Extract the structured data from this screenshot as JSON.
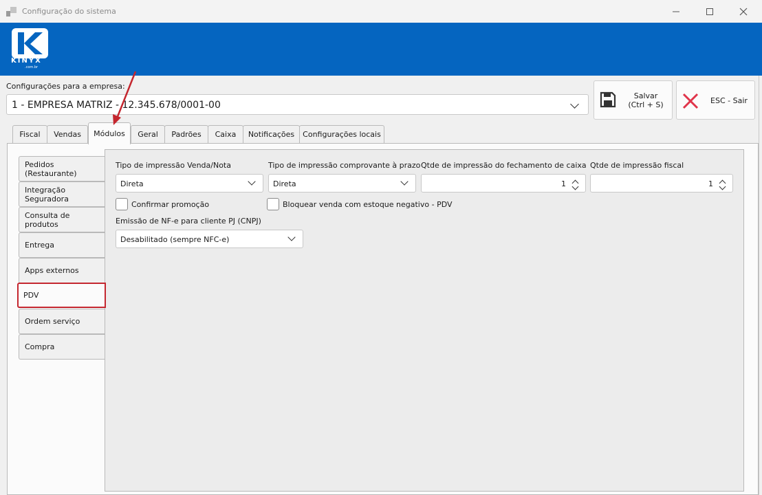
{
  "window": {
    "title": "Configuração do sistema"
  },
  "banner": {
    "logo_text": "KINYX",
    "logo_sub": ".com.br"
  },
  "company": {
    "label": "Configurações para a empresa:",
    "value": "1 - EMPRESA MATRIZ - 12.345.678/0001-00"
  },
  "toolbar": {
    "save_label_line1": "Salvar",
    "save_label_line2": "(Ctrl + S)",
    "exit_label": "ESC - Sair"
  },
  "tabs": [
    {
      "label": "Fiscal"
    },
    {
      "label": "Vendas"
    },
    {
      "label": "Módulos"
    },
    {
      "label": "Geral"
    },
    {
      "label": "Padrões"
    },
    {
      "label": "Caixa"
    },
    {
      "label": "Notificações"
    },
    {
      "label": "Configurações locais"
    }
  ],
  "active_tab": "Módulos",
  "modules": [
    {
      "label": "Pedidos (Restaurante)"
    },
    {
      "label": "Integração Seguradora"
    },
    {
      "label": "Consulta de produtos"
    },
    {
      "label": "Entrega"
    },
    {
      "label": "Apps externos"
    },
    {
      "label": "PDV"
    },
    {
      "label": "Ordem serviço"
    },
    {
      "label": "Compra"
    }
  ],
  "active_module": "PDV",
  "pdv": {
    "tipo_venda_label": "Tipo de impressão Venda/Nota",
    "tipo_venda_value": "Direta",
    "tipo_prazo_label": "Tipo de impressão comprovante à prazo",
    "tipo_prazo_value": "Direta",
    "qtde_fechamento_label": "Qtde de impressão do fechamento de caixa",
    "qtde_fechamento_value": "1",
    "qtde_fiscal_label": "Qtde de impressão fiscal",
    "qtde_fiscal_value": "1",
    "confirmar_promocao_label": "Confirmar promoção",
    "bloquear_venda_label": "Bloquear venda com estoque negativo - PDV",
    "emissao_label": "Emissão de NF-e para cliente PJ (CNPJ)",
    "emissao_value": "Desabilitado (sempre NFC-e)"
  },
  "colors": {
    "banner": "#0565c0",
    "highlight": "#c4262e",
    "exit_icon": "#e0344a"
  }
}
